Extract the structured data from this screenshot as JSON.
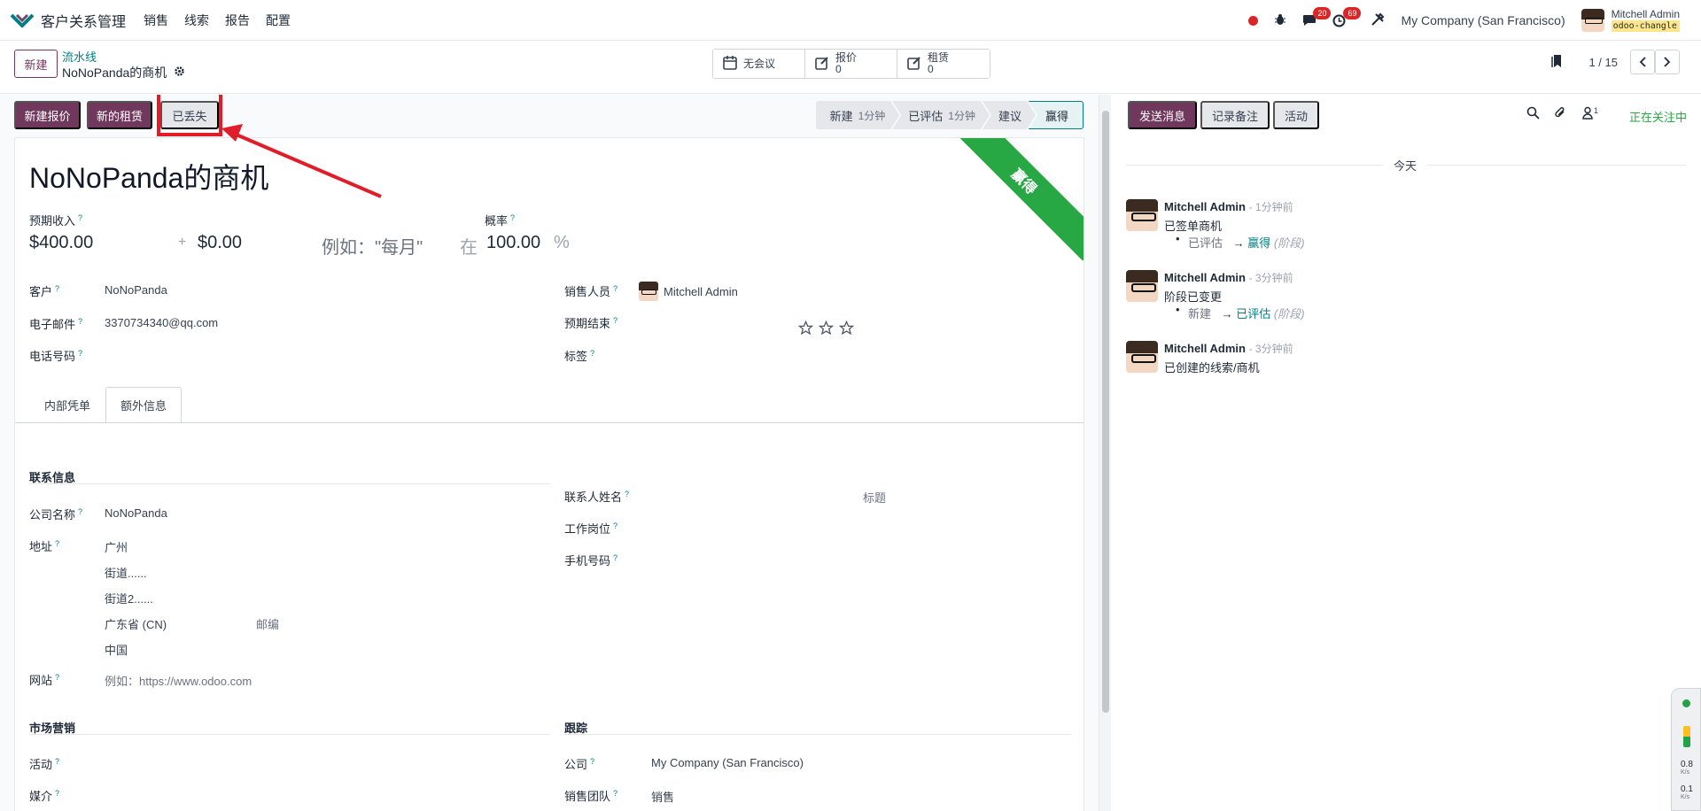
{
  "navbar": {
    "app_name": "客户关系管理",
    "menu": [
      "销售",
      "线索",
      "报告",
      "配置"
    ],
    "messages_badge": "20",
    "activities_badge": "69",
    "company": "My Company (San Francisco)",
    "user_name": "Mitchell Admin",
    "db_name": "odoo-changle"
  },
  "control": {
    "new_label": "新建",
    "breadcrumb": "流水线",
    "record_title": "NoNoPanda的商机",
    "smart_buttons": [
      {
        "label": "无会议",
        "count": ""
      },
      {
        "label": "报价",
        "count": "0"
      },
      {
        "label": "租赁",
        "count": "0"
      }
    ],
    "pager": "1 / 15"
  },
  "statusbar": {
    "buttons": [
      "新建报价",
      "新的租赁",
      "已丢失"
    ],
    "stages": [
      {
        "name": "新建",
        "duration": "1分钟"
      },
      {
        "name": "已评估",
        "duration": "1分钟"
      },
      {
        "name": "建议",
        "duration": ""
      },
      {
        "name": "赢得",
        "duration": ""
      }
    ]
  },
  "form": {
    "ribbon": "赢得",
    "name": "NoNoPanda的商机",
    "expected_revenue_label": "预期收入",
    "probability_label": "概率",
    "expected_revenue": "$400.00",
    "plus": "+",
    "recurring": "$0.00",
    "recurring_placeholder": "例如：\"每月\"",
    "at": "在",
    "probability": "100.00",
    "percent": "%",
    "customer_label": "客户",
    "customer": "NoNoPanda",
    "email_label": "电子邮件",
    "email": "3370734340@qq.com",
    "phone_label": "电话号码",
    "salesperson_label": "销售人员",
    "salesperson": "Mitchell Admin",
    "deadline_label": "预期结束",
    "tags_label": "标签",
    "tabs": [
      "内部凭单",
      "额外信息"
    ],
    "contact_section": "联系信息",
    "company_name_label": "公司名称",
    "company_name": "NoNoPanda",
    "address_label": "地址",
    "city": "广州",
    "street": "街道......",
    "street2": "街道2......",
    "state": "广东省 (CN)",
    "zip_placeholder": "邮编",
    "country": "中国",
    "website_label": "网站",
    "website_placeholder": "例如：https://www.odoo.com",
    "contact_name_label": "联系人姓名",
    "title_placeholder": "标题",
    "job_label": "工作岗位",
    "mobile_label": "手机号码",
    "marketing_section": "市场营销",
    "campaign_label": "活动",
    "medium_label": "媒介",
    "tracking_section": "跟踪",
    "company_label": "公司",
    "company_value": "My Company (San Francisco)",
    "team_label": "销售团队",
    "team_value": "销售"
  },
  "chatter": {
    "send_message": "发送消息",
    "log_note": "记录备注",
    "activity": "活动",
    "followers_count": "1",
    "following": "正在关注中",
    "today": "今天",
    "messages": [
      {
        "author": "Mitchell Admin",
        "time": "- 1分钟前",
        "body": "已签单商机",
        "from": "已评估",
        "arrow": "→",
        "to": "赢得",
        "field": "(阶段)"
      },
      {
        "author": "Mitchell Admin",
        "time": "- 3分钟前",
        "body": "阶段已变更",
        "from": "新建",
        "arrow": "→",
        "to": "已评估",
        "field": "(阶段)"
      },
      {
        "author": "Mitchell Admin",
        "time": "- 3分钟前",
        "body": "已创建的线索/商机",
        "from": "",
        "arrow": "",
        "to": "",
        "field": ""
      }
    ]
  },
  "widget": {
    "up": "0.8",
    "down": "0.1",
    "unit": "K/s"
  }
}
